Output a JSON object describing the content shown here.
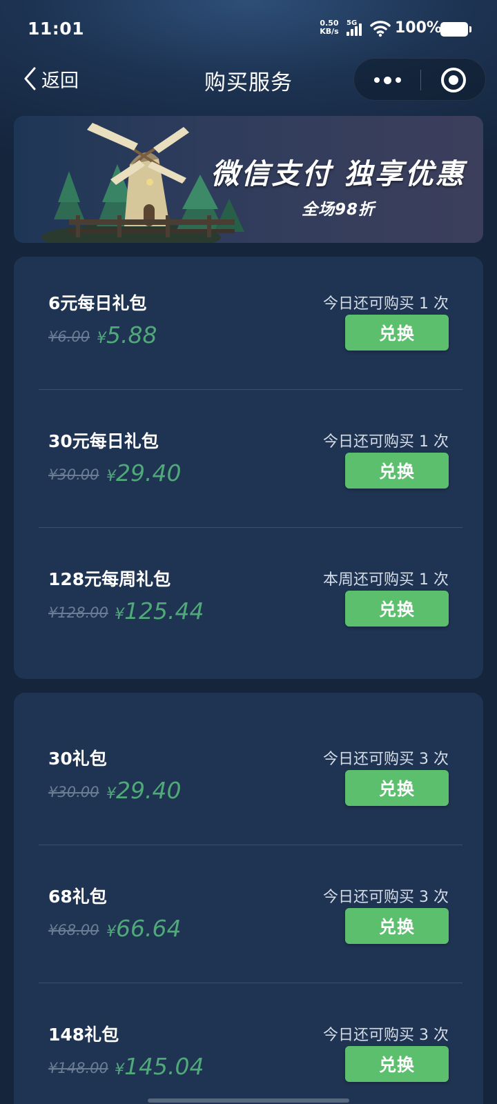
{
  "status_bar": {
    "time": "11:01",
    "net_speed_value": "0.50",
    "net_speed_unit": "KB/s",
    "network_type": "5G",
    "battery_percent": "100%"
  },
  "nav": {
    "back_label": "返回",
    "title": "购买服务"
  },
  "banner": {
    "headline": "微信支付 独享优惠",
    "subline": "全场98折"
  },
  "button_label": "兑换",
  "packages_group_1": [
    {
      "name": "6元每日礼包",
      "original_price": "¥6.00",
      "sale_price": "5.88",
      "limit_text": "今日还可购买 1 次"
    },
    {
      "name": "30元每日礼包",
      "original_price": "¥30.00",
      "sale_price": "29.40",
      "limit_text": "今日还可购买 1 次"
    },
    {
      "name": "128元每周礼包",
      "original_price": "¥128.00",
      "sale_price": "125.44",
      "limit_text": "本周还可购买 1 次"
    }
  ],
  "packages_group_2": [
    {
      "name": "30礼包",
      "original_price": "¥30.00",
      "sale_price": "29.40",
      "limit_text": "今日还可购买 3 次"
    },
    {
      "name": "68礼包",
      "original_price": "¥68.00",
      "sale_price": "66.64",
      "limit_text": "今日还可购买 3 次"
    },
    {
      "name": "148礼包",
      "original_price": "¥148.00",
      "sale_price": "145.04",
      "limit_text": "今日还可购买 3 次"
    }
  ],
  "currency_symbol": "¥",
  "colors": {
    "background": "#14253c",
    "card": "#1f3452",
    "button": "#5bbf6e",
    "sale_price": "#4fa978",
    "original_price": "#6a7d94"
  }
}
